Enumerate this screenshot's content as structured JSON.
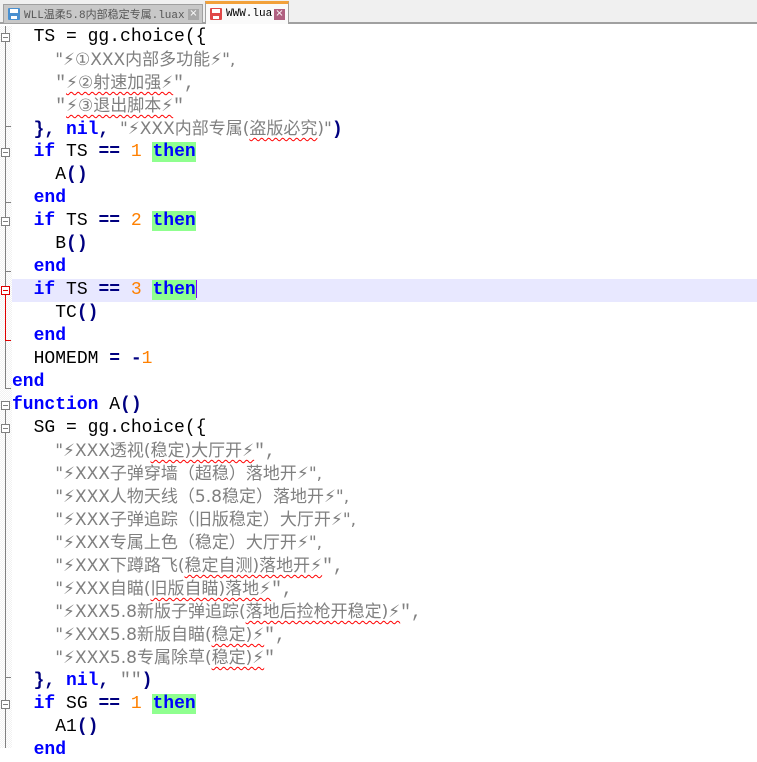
{
  "tabs": [
    {
      "label": "WLL温柔5.8内部稳定专属.luax",
      "icon": "save-disk-icon",
      "active": false,
      "close": "×"
    },
    {
      "label": "WWW.lua",
      "icon": "save-disk-icon-modified",
      "active": true,
      "close": "×"
    }
  ],
  "code": {
    "ts_assign": "TS = gg.choice({",
    "ts_opt1": "\"⚡①XXX内部多功能⚡\",",
    "ts_opt2_q": "\"",
    "ts_opt2": "⚡②射速加强⚡",
    "ts_opt2_end": "\",",
    "ts_opt3_q": "\"",
    "ts_opt3": "⚡③退出脚本⚡",
    "ts_opt3_end": "\"",
    "ts_close_brace": "}, ",
    "nil": "nil",
    "comma": ", ",
    "ts_title_a": "\"⚡XXX内部专属(",
    "ts_title_b": "盗版必究",
    "ts_title_c": ")\"",
    "paren_close": ")",
    "if": "if",
    "then": "then",
    "end": "end",
    "function": "function",
    "ts_var": " TS ",
    "sg_var": " SG ",
    "eq": "==",
    "one": "1",
    "two": "2",
    "three": "3",
    "call_a": "A",
    "call_b": "B",
    "call_tc": "TC",
    "call_a1": "A1",
    "parens": "()",
    "homedm": "HOMEDM ",
    "assign": "=",
    "minus": " -",
    "fn_name": " A",
    "sg_assign": "SG = gg.choice({",
    "sg_opts": [
      {
        "pre": "\"⚡XXX透视(",
        "sq": "稳定)大厅开⚡",
        "post": "\","
      },
      {
        "pre": "\"⚡XXX子弹穿墙（超稳）落地开⚡\",",
        "sq": "",
        "post": ""
      },
      {
        "pre": "\"⚡XXX人物天线（5.8稳定）落地开⚡\",",
        "sq": "",
        "post": ""
      },
      {
        "pre": "\"⚡XXX子弹追踪（旧版稳定）大厅开⚡\",",
        "sq": "",
        "post": ""
      },
      {
        "pre": "\"⚡XXX专属上色（稳定）大厅开⚡\",",
        "sq": "",
        "post": ""
      },
      {
        "pre": "\"⚡XXX下蹲路飞(",
        "sq": "稳定自测)落地开⚡",
        "post": "\","
      },
      {
        "pre": "\"⚡XXX自瞄(",
        "sq": "旧版自瞄)落地⚡",
        "post": "\","
      },
      {
        "pre": "\"⚡XXX5.8新版子弹追踪(",
        "sq": "落地后捡枪开稳定)⚡",
        "post": "\","
      },
      {
        "pre": "\"⚡XXX5.8新版自瞄(",
        "sq": "稳定)⚡",
        "post": "\","
      },
      {
        "pre": "\"⚡XXX5.8专属除草(",
        "sq": "稳定)⚡",
        "post": "\""
      }
    ],
    "empty_str": "\"\""
  }
}
